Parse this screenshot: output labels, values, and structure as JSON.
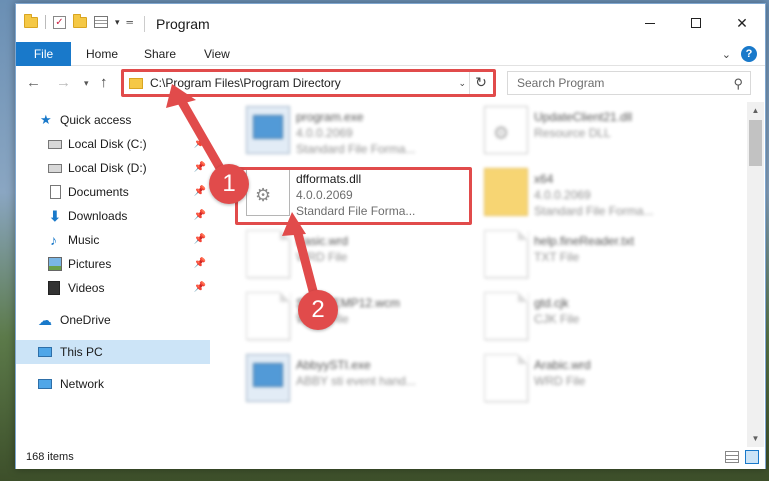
{
  "window": {
    "title": "Program",
    "minimize_label": "—",
    "maximize_label": "",
    "close_label": "✕"
  },
  "ribbon": {
    "tabs": [
      {
        "label": "File"
      },
      {
        "label": "Home"
      },
      {
        "label": "Share"
      },
      {
        "label": "View"
      }
    ],
    "help_label": "?"
  },
  "navigation": {
    "address": "C:\\Program Files\\Program Directory",
    "search_placeholder": "Search Program"
  },
  "sidebar": {
    "items": [
      {
        "label": "Quick access",
        "pinned": false
      },
      {
        "label": "Local Disk (C:)",
        "pinned": true
      },
      {
        "label": "Local Disk (D:)",
        "pinned": true
      },
      {
        "label": "Documents",
        "pinned": true
      },
      {
        "label": "Downloads",
        "pinned": true
      },
      {
        "label": "Music",
        "pinned": true
      },
      {
        "label": "Pictures",
        "pinned": true
      },
      {
        "label": "Videos",
        "pinned": true
      },
      {
        "label": "OneDrive",
        "pinned": false
      },
      {
        "label": "This PC",
        "pinned": false,
        "selected": true
      },
      {
        "label": "Network",
        "pinned": false
      }
    ]
  },
  "files": [
    {
      "name": "program.exe",
      "line2": "4.0.0.2069",
      "line3": "Standard File Forma...",
      "icon": "exe-icon",
      "blurred": true
    },
    {
      "name": "UpdateClient21.dll",
      "line2": "Resource DLL",
      "line3": "",
      "icon": "gear-doc-icon",
      "blurred": true
    },
    {
      "name": "dfformats.dll",
      "line2": "4.0.0.2069",
      "line3": "Standard File Forma...",
      "icon": "gear-doc-icon",
      "blurred": false
    },
    {
      "name": "x64",
      "line2": "4.0.0.2069",
      "line3": "Standard File Forma...",
      "icon": "folder-icon",
      "blurred": true
    },
    {
      "name": "Basic.wrd",
      "line2": "WRD File",
      "line3": "",
      "icon": "doc-icon",
      "blurred": true
    },
    {
      "name": "help.fineReader.txt",
      "line2": "TXT File",
      "line3": "",
      "icon": "doc-icon",
      "blurred": true
    },
    {
      "name": "Snow_EMP12.wcm",
      "line2": "WCM File",
      "line3": "",
      "icon": "doc-icon",
      "blurred": true
    },
    {
      "name": "gtd.cjk",
      "line2": "CJK File",
      "line3": "",
      "icon": "doc-icon",
      "blurred": true
    },
    {
      "name": "AbbyySTI.exe",
      "line2": "ABBY sti event hand...",
      "line3": "",
      "icon": "exe-icon",
      "blurred": true
    },
    {
      "name": "Arabic.wrd",
      "line2": "WRD File",
      "line3": "",
      "icon": "doc-icon",
      "blurred": true
    }
  ],
  "status": {
    "item_count": "168 items"
  },
  "annotations": {
    "step1": "1",
    "step2": "2",
    "color": "#e14b4b"
  },
  "colors": {
    "accent": "#1979ca",
    "selection": "#cce4f7",
    "highlight": "#e14b4b"
  }
}
